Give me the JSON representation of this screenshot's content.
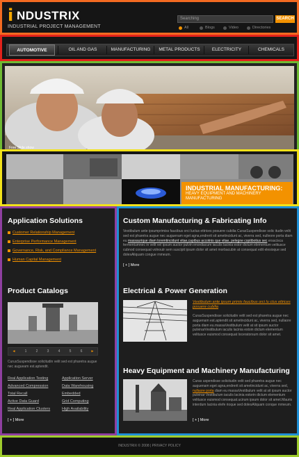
{
  "brand": {
    "logo_letter": "i",
    "logo_word": "NDUSTRIX",
    "tagline": "INDUSTRIAL PROJECT MANAGEMENT"
  },
  "search": {
    "placeholder": "Searching",
    "button": "SEARCH",
    "options": [
      "All",
      "Blogs",
      "Video",
      "Directories"
    ],
    "selected": "All"
  },
  "nav": {
    "items": [
      "AUTOMOTIVE",
      "OIL AND GAS",
      "MANUFACTURING",
      "METAL PRODUCTS",
      "ELECTRICITY",
      "CHEMICALS"
    ],
    "active": "AUTOMOTIVE"
  },
  "hero": {
    "tag": "Free Slide show"
  },
  "strip": {
    "title": "INDUSTRIAL MANUFACTURING:",
    "subtitle_1": "HEAVY EQUIPMENT AND MACHINERY",
    "subtitle_2": "MANUFACTURING"
  },
  "applications": {
    "title": "Application Solutions",
    "items": [
      "Customer Relationship Management",
      "Enterprise Performance Management",
      "Governance, Risk, and Compliance Management",
      "Human Capital Management"
    ]
  },
  "catalogs": {
    "title": "Product Catalogs",
    "pages": [
      "1",
      "2",
      "3",
      "4",
      "5",
      "6"
    ],
    "caption": "CurusSuspendisse solicitudin velit sed est pharetra augue nec augueam est.aptendit.",
    "links_left": [
      "Real Application Testing",
      "Advanced Compression",
      "Total Recall",
      "Active Data Guard",
      "Real Application Clusters"
    ],
    "links_right": [
      "Application Server",
      "Data Warehousing",
      "Embedded",
      "Grid Computing",
      "High Availability"
    ],
    "more": "[ + ] More"
  },
  "custom_mfg": {
    "title": "Custom Manufacturing & Fabricating Info",
    "text_1": "Vestibulum ante ipsumprimiss faucibus orci luctus ettrices posuere cubilia CurasSuspendisse solic itudin velit sed est pharetra augue nec auguenam eget agna,endrerit sit ametincidunt ac, viverra sed, nulleore porta diam eu",
    "highlight": "massaurique diam loremtincidunt vitae,capibus accotnis que vitae, pelegne coptibotius sec",
    "text_2": "ersacisca fermentumnec in velit vel ipsum auctor pulvin enordiacum iaculis lacinia estor dictum elementum velitusce cubnod consequat volnoutr sem suscipit ipsum dolor sit amet morbacubin at consequat edit elesioque sed dolesAliquam congue rnmeum.",
    "more": "[ + ] More"
  },
  "electrical": {
    "title": "Electrical & Power Generation",
    "link": "Vestibulum ante ipsum primis faucibus orci lu ctus ettrices posuere cubilia",
    "text": "CurasSuspendisse solicitudin velit sed est pharetra augue nec auguenam est.aptendit sit ametincidunt ac, viverra sed, nullaore porta diam eu.massaVestibulum velit at sit ipsum auctor pulvinarVestibulum iaculis lacinia estoin dictum elementum velitusce euismod consequat loceratorsum dolor sit amet."
  },
  "heavy": {
    "title": "Heavy Equipment and Machinery Manufacturing",
    "text_1": "Curas uspendisse solicitudin velit sed pharetra augue nec auguenam eget agna,endrerit sit ametincidunt ac, viverra sed,",
    "highlight": "nullaore porta",
    "text_2": "diam eu massaVestibulum velit at sit ipsum auctor pulvinar VestibuIum iaculis lacinia estorin dictum elementum velitusce euismod consequat.ucirum ipsum dolor sit amet.Mauris interdum lacinia elefe rioque sed dolesAliquam conque rnmeum.",
    "more": "[ + ] More"
  },
  "footer": {
    "text": "INDUSTRIX © 2008  |  PRIVACY POLICY"
  },
  "colors": {
    "accent": "#f39200",
    "background": "#1e1e1e"
  }
}
